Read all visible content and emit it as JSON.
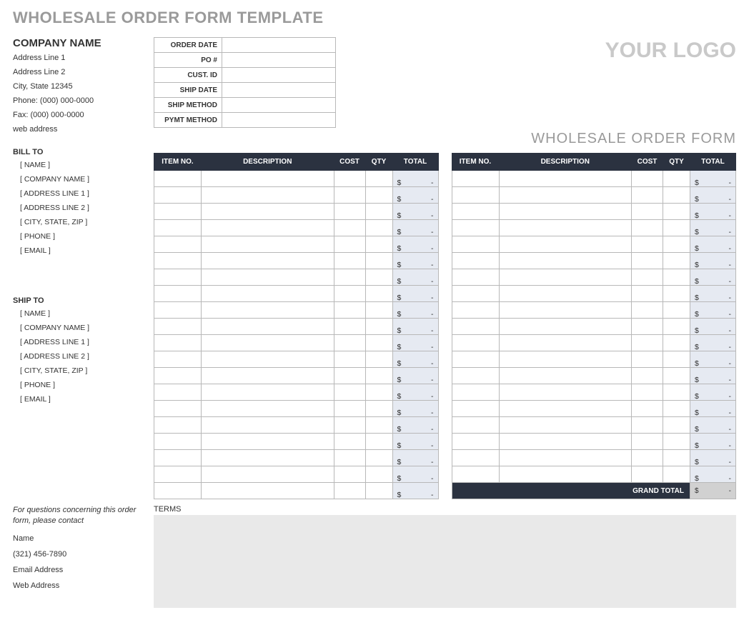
{
  "page_title": "WHOLESALE ORDER FORM TEMPLATE",
  "company": {
    "name": "COMPANY NAME",
    "address1": "Address Line 1",
    "address2": "Address Line 2",
    "city_state_zip": "City, State  12345",
    "phone": "Phone: (000) 000-0000",
    "fax": "Fax: (000) 000-0000",
    "web": "web address"
  },
  "meta_labels": {
    "order_date": "ORDER DATE",
    "po": "PO #",
    "cust_id": "CUST. ID",
    "ship_date": "SHIP DATE",
    "ship_method": "SHIP METHOD",
    "pymt_method": "PYMT METHOD"
  },
  "meta_values": {
    "order_date": "",
    "po": "",
    "cust_id": "",
    "ship_date": "",
    "ship_method": "",
    "pymt_method": ""
  },
  "logo_text": "YOUR LOGO",
  "form_title": "WHOLESALE ORDER FORM",
  "bill_to": {
    "heading": "BILL TO",
    "name": "[ NAME ]",
    "company": "[ COMPANY NAME ]",
    "address1": "[ ADDRESS LINE 1 ]",
    "address2": "[ ADDRESS LINE 2 ]",
    "city_state_zip": "[ CITY, STATE, ZIP ]",
    "phone": "[ PHONE ]",
    "email": "[ EMAIL ]"
  },
  "ship_to": {
    "heading": "SHIP TO",
    "name": "[ NAME ]",
    "company": "[ COMPANY NAME ]",
    "address1": "[ ADDRESS LINE 1 ]",
    "address2": "[ ADDRESS LINE 2 ]",
    "city_state_zip": "[ CITY, STATE, ZIP ]",
    "phone": "[ PHONE ]",
    "email": "[ EMAIL ]"
  },
  "items_header": {
    "item_no": "ITEM NO.",
    "description": "DESCRIPTION",
    "cost": "COST",
    "qty": "QTY",
    "total": "TOTAL"
  },
  "left_rows": 20,
  "right_rows": 19,
  "total_placeholder": {
    "symbol": "$",
    "dash": "-"
  },
  "grand_total_label": "GRAND TOTAL",
  "grand_total_value": {
    "symbol": "$",
    "dash": "-"
  },
  "footer": {
    "note": "For questions concerning this order form, please contact",
    "contact_name": "Name",
    "contact_phone": "(321) 456-7890",
    "contact_email": "Email Address",
    "contact_web": "Web Address",
    "terms_label": "TERMS",
    "terms_text": ""
  }
}
